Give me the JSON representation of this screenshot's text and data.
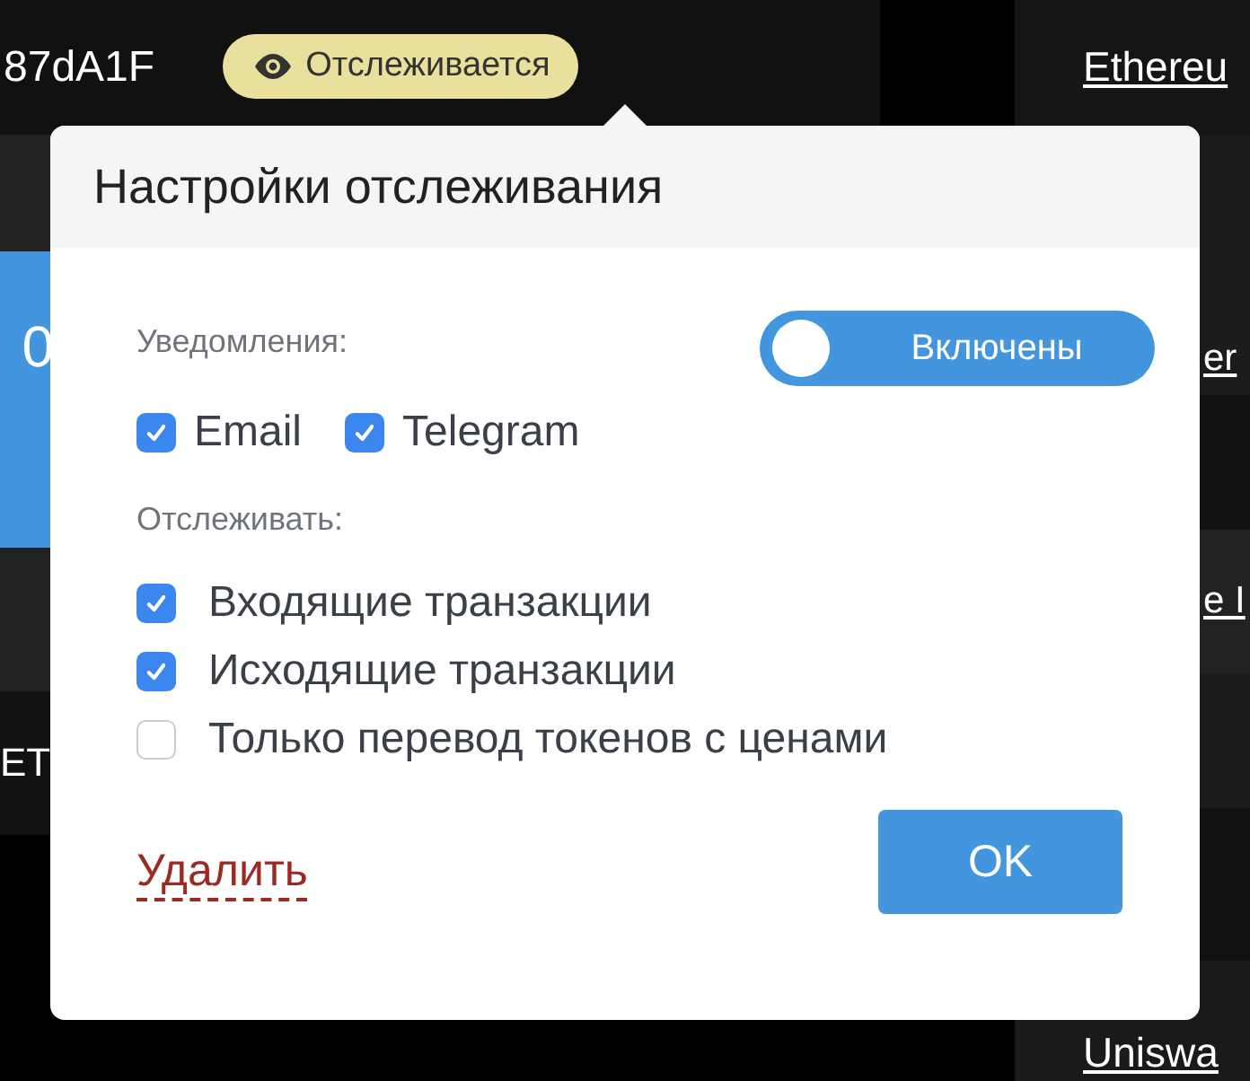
{
  "background": {
    "address": "87dA1F",
    "badge": "Отслеживается",
    "amount": "0",
    "currency": "ET",
    "right_links": [
      "Ethereu",
      "er",
      "e I",
      "Uniswa"
    ]
  },
  "dialog": {
    "title": "Настройки отслеживания",
    "notifications": {
      "label": "Уведомления:",
      "toggle": {
        "label": "Включены",
        "on": true
      },
      "channels": [
        {
          "label": "Email",
          "checked": true
        },
        {
          "label": "Telegram",
          "checked": true
        }
      ]
    },
    "track": {
      "label": "Отслеживать:",
      "options": [
        {
          "label": "Входящие транзакции",
          "checked": true
        },
        {
          "label": "Исходящие транзакции",
          "checked": true
        },
        {
          "label": "Только перевод токенов с ценами",
          "checked": false
        }
      ]
    },
    "delete_link": "Удалить",
    "ok_button": "OK"
  }
}
